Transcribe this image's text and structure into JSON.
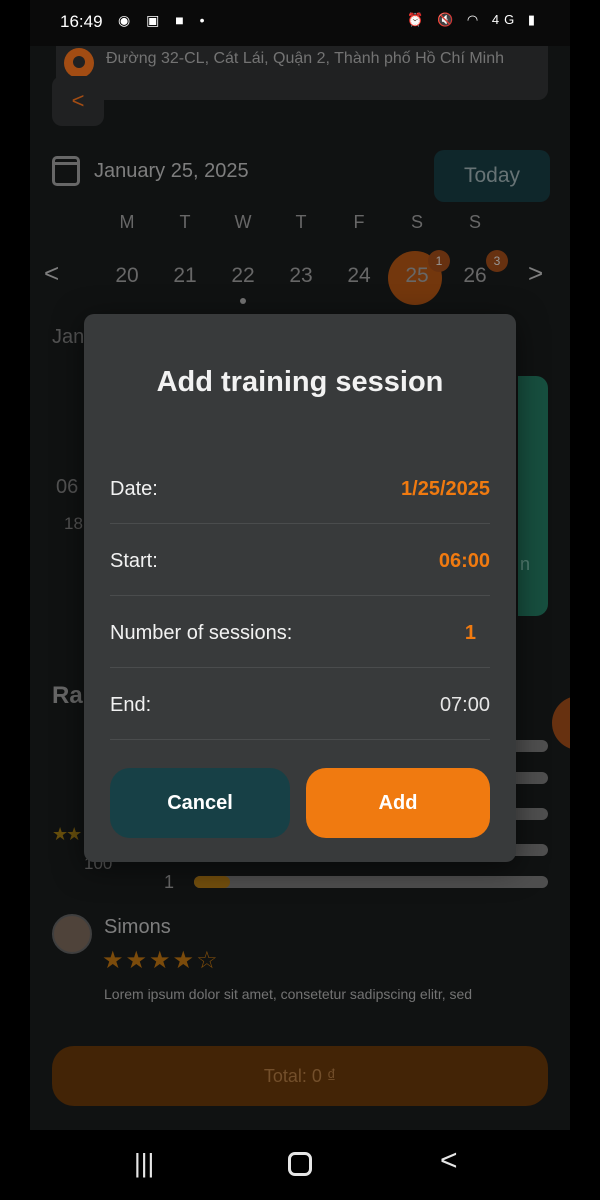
{
  "status_bar": {
    "time": "16:49",
    "left_icons": "◉ ▣ ■ •",
    "right_icons": "⏰ 🔇 ◠ 4G ▮"
  },
  "address": {
    "text": "Đường 32-CL, Cát Lái, Quận 2, Thành phố Hồ Chí Minh"
  },
  "back": {
    "icon": "chevron-left-icon",
    "glyph": "<"
  },
  "date_header": {
    "selected_date": "January 25, 2025",
    "today_label": "Today"
  },
  "week": {
    "weekdays": [
      "M",
      "T",
      "W",
      "T",
      "F",
      "S",
      "S"
    ],
    "days": [
      "20",
      "21",
      "22",
      "23",
      "24",
      "25",
      "26"
    ],
    "selected_index": 5,
    "badges": {
      "25": "1",
      "26": "3"
    },
    "prev_glyph": "<",
    "next_glyph": ">"
  },
  "background": {
    "jan_fragment": "Jan",
    "time_fragment_a": "06",
    "time_fragment_b": "18",
    "card_fragment": "n",
    "ratings_fragment": "Ra",
    "bar_level_label": "1",
    "review_count": "100",
    "left_stars": "★★",
    "reviewer_name": "Simons",
    "reviewer_stars": "★★★★☆",
    "review_text": "Lorem ipsum dolor sit amet, consetetur sadipscing elitr, sed",
    "total_label": "Total: 0 ₫"
  },
  "dialog": {
    "title": "Add training session",
    "rows": [
      {
        "label": "Date:",
        "value": "1/25/2025"
      },
      {
        "label": "Start:",
        "value": "06:00"
      },
      {
        "label": "Number of sessions:",
        "value": "1"
      },
      {
        "label": "End:",
        "value": "07:00"
      }
    ],
    "cancel_label": "Cancel",
    "add_label": "Add"
  },
  "nav": {
    "recent_glyph": "|||",
    "back_glyph": "<"
  },
  "colors": {
    "accent": "#f07a10",
    "dialog_bg": "#383a3b",
    "cancel_bg": "#174046",
    "background": "#161819"
  }
}
